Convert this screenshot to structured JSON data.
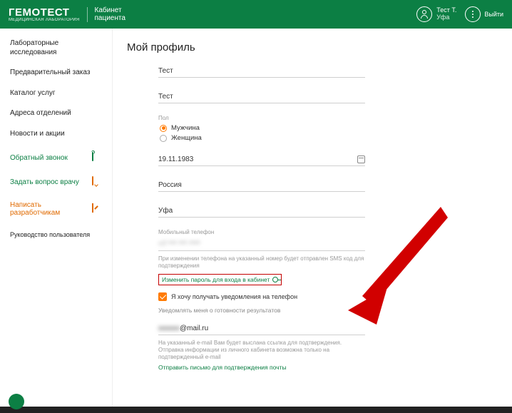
{
  "header": {
    "logo": "ГЕМОТЕСТ",
    "logo_sub": "МЕДИЦИНСКАЯ ЛАБОРАТОРИЯ",
    "section_l1": "Кабинет",
    "section_l2": "пациента",
    "user_name": "Тест Т.",
    "user_city": "Уфа",
    "logout": "Выйти"
  },
  "sidebar": {
    "nav": [
      "Лабораторные исследования",
      "Предварительный заказ",
      "Каталог услуг",
      "Адреса отделений",
      "Новости и акции"
    ],
    "callback": "Обратный звонок",
    "ask_doctor": "Задать вопрос врачу",
    "write_devs": "Написать разработчикам",
    "manual": "Руководство пользователя"
  },
  "profile": {
    "title": "Мой профиль",
    "last_name": "Тест",
    "first_name": "Тест",
    "gender_label": "Пол",
    "gender_male": "Мужчина",
    "gender_female": "Женщина",
    "birthdate": "19.11.1983",
    "country": "Россия",
    "city": "Уфа",
    "phone_label": "Мобильный телефон",
    "phone_value": "+7 *** *** ****",
    "phone_hint": "При изменении телефона на указанный номер будет отправлен SMS код для подтверждения",
    "change_password": "Изменить пароль для входа в кабинет",
    "notify_phone": "Я хочу получать уведомления на телефон",
    "notify_heading": "Уведомлять меня о готовности результатов",
    "email_value": "@mail.ru",
    "email_masked": "xxxxxx",
    "email_hint": "На указанный e-mail Вам будет выслана ссылка для подтверждения. Отправка информации из личного кабинета возможна только на подтвержденный e-mail",
    "resend": "Отправить письмо для подтверждения почты"
  }
}
